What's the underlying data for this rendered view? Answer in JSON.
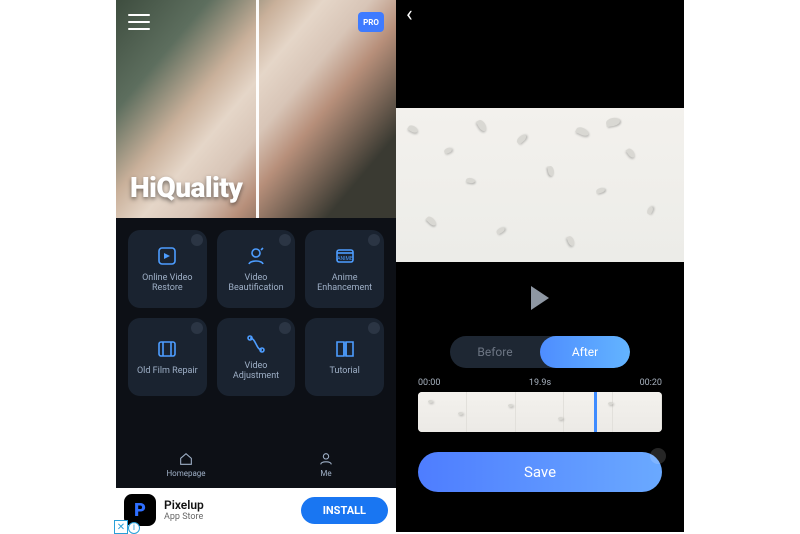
{
  "left": {
    "hero_title": "HiQuality",
    "pro_badge": "PRO",
    "tiles": [
      {
        "label": "Online Video Restore"
      },
      {
        "label": "Video Beautification"
      },
      {
        "label": "Anime Enhancement"
      },
      {
        "label": "Old Film Repair"
      },
      {
        "label": "Video Adjustment"
      },
      {
        "label": "Tutorial"
      }
    ],
    "nav": {
      "home": "Homepage",
      "me": "Me"
    },
    "ad": {
      "title": "Pixelup",
      "subtitle": "App Store",
      "cta": "INSTALL"
    }
  },
  "right": {
    "toggle": {
      "before": "Before",
      "after": "After"
    },
    "timeline": {
      "start": "00:00",
      "mid": "19.9s",
      "end": "00:20",
      "playhead_pct": 72
    },
    "save_label": "Save"
  }
}
